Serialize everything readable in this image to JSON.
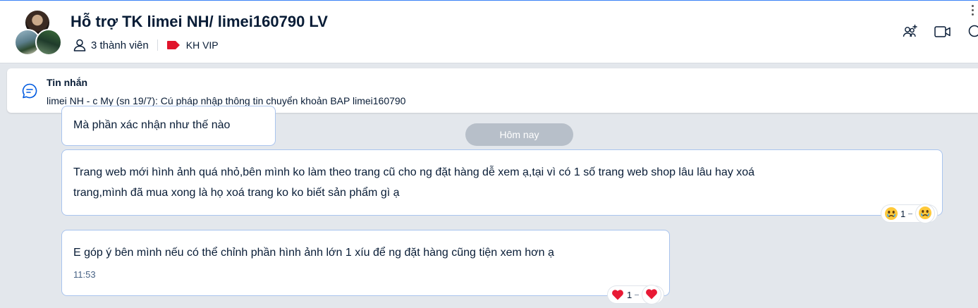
{
  "header": {
    "title": "Hỗ trợ TK limei NH/ limei160790 LV",
    "member_count": "3 thành viên",
    "tag_label": "KH VIP",
    "tag_color": "#e0142b",
    "actions": [
      "add-member-icon",
      "video-call-icon",
      "search-icon",
      "more-icon"
    ]
  },
  "pinned": {
    "title": "Tin nhắn",
    "text": "limei NH - c My (sn 19/7): Cú pháp nhập thông tin chuyển khoản BAP limei160790"
  },
  "date_separator": "Hôm nay",
  "messages": [
    {
      "text": "Mà phần xác nhận như thế nào"
    },
    {
      "text_line1": "Trang web mới hình ảnh quá nhỏ,bên mình ko làm theo trang cũ cho ng đặt hàng dễ xem ạ,tại vì có 1 số trang web shop lâu lâu hay xoá",
      "text_line2": "trang,mình đã mua xong là họ xoá trang ko ko biết sản phẩm gì ạ",
      "reaction": {
        "icon": "crying-face-icon",
        "count": "1"
      }
    },
    {
      "text": "E góp ý bên mình nếu có thể chỉnh phần hình ảnh lớn 1 xíu để ng đặt hàng cũng tiện xem hơn ạ",
      "time": "11:53",
      "reaction": {
        "icon": "heart-icon",
        "count": "1"
      }
    }
  ],
  "colors": {
    "accent": "#005ae0",
    "bubble_border": "#a9c4ee",
    "background": "#e3e7ec"
  }
}
